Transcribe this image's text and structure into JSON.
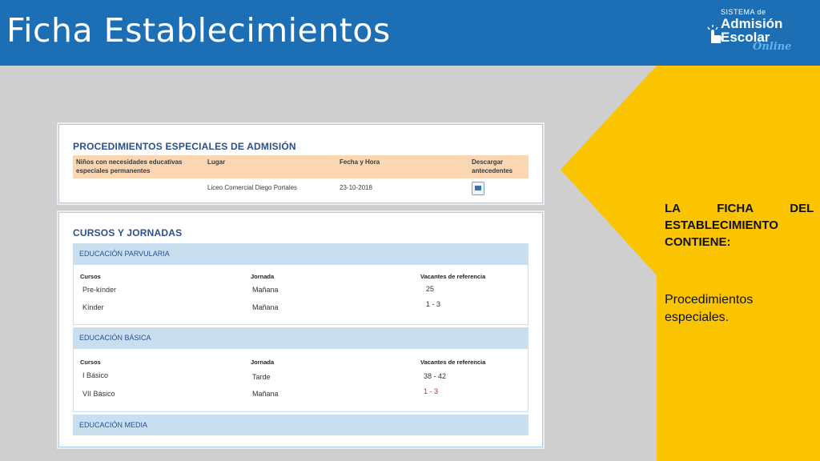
{
  "header": {
    "title": "Ficha Establecimientos"
  },
  "logo": {
    "line1": "SISTEMA de",
    "line2": "Admisión",
    "line3": "Escolar",
    "line4": "Online"
  },
  "side": {
    "heading_words": [
      "LA",
      "FICHA",
      "DEL",
      "ESTABLECIMIENTO",
      "CONTIENE:"
    ],
    "body": "Procedimientos especiales."
  },
  "procedimientos": {
    "title": "PROCEDIMIENTOS ESPECIALES DE ADMISIÓN",
    "columns": [
      "Niños con necesidades educativas especiales permanentes",
      "Lugar",
      "Fecha y Hora",
      "Descargar antecedentes"
    ],
    "row": {
      "lugar": "Liceo Comercial Diego Portales",
      "fecha": "23-10-2018"
    },
    "download_icon": "pdf-download-icon"
  },
  "cursos": {
    "title": "CURSOS Y JORNADAS",
    "sections": [
      {
        "name": "EDUCACIÓN PARVULARIA",
        "columns": [
          "Cursos",
          "Jornada",
          "Vacantes de referencia"
        ],
        "rows": [
          {
            "curso": "Pre-kínder",
            "jornada": "Mañana",
            "vacantes": "25"
          },
          {
            "curso": "Kínder",
            "jornada": "Mañana",
            "vacantes": "1 - 3"
          }
        ]
      },
      {
        "name": "EDUCACIÓN BÁSICA",
        "columns": [
          "Cursos",
          "Jornada",
          "Vacantes de referencia"
        ],
        "rows": [
          {
            "curso": "I Básico",
            "jornada": "Tarde",
            "vacantes": "38 - 42"
          },
          {
            "curso": "VII Básico",
            "jornada": "Mañana",
            "vacantes": "1 - 3"
          }
        ]
      },
      {
        "name": "EDUCACIÓN MEDIA"
      }
    ]
  },
  "colors": {
    "header_blue": "#1c6fb5",
    "accent_yellow": "#fbc400",
    "table_header_peach": "#fbd6b3",
    "section_blue": "#c9dff0"
  }
}
